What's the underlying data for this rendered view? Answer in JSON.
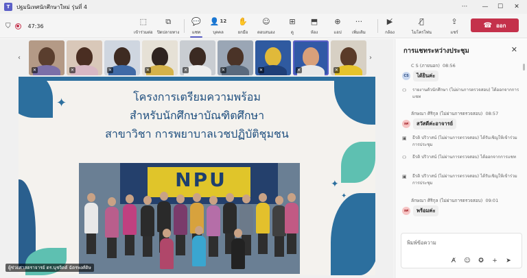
{
  "window": {
    "title": "ปฐมนิเทศนักศึกษาใหม่ รุ่นที่ 4",
    "app_icon": "T"
  },
  "toolbar": {
    "timer": "47:36",
    "buttons": [
      {
        "label": "เข้าร่วมต่อ",
        "icon": "join-icon"
      },
      {
        "label": "ปิดปลายทาง",
        "icon": "panel-icon"
      },
      {
        "label": "แชท",
        "icon": "chat-icon"
      },
      {
        "label": "บุคคล",
        "icon": "people-icon",
        "count": "12"
      },
      {
        "label": "ยกมือ",
        "icon": "raise-hand-icon"
      },
      {
        "label": "ตอบสนอง",
        "icon": "react-icon"
      },
      {
        "label": "ดู",
        "icon": "view-icon"
      },
      {
        "label": "ห้อง",
        "icon": "rooms-icon"
      },
      {
        "label": "แอป",
        "icon": "apps-icon"
      },
      {
        "label": "เพิ่มเติม",
        "icon": "more-icon"
      },
      {
        "label": "กล้อง",
        "icon": "camera-off-icon"
      },
      {
        "label": "ไมโครโฟน",
        "icon": "mic-off-icon"
      },
      {
        "label": "แชร์",
        "icon": "share-icon"
      }
    ],
    "leave_label": "ออก"
  },
  "stage": {
    "presenter_caption": "ผู้ช่วยศาสตราจารย์ ดร.นุชจิตต์ ฉัตรพงศ์ดิษ"
  },
  "slide": {
    "line1": "โครงการเตรียมความพร้อม",
    "line2": "สำหรับนักศึกษาบัณฑิตศึกษา",
    "line3": "สาขาวิชา การพยาบาลเวชปฏิบัติชุมชน",
    "banner_text": "NPU"
  },
  "chat": {
    "title": "การแชทระหว่างประชุม",
    "messages": [
      {
        "sender": "C S (ภายนอก)",
        "time": "08:56",
        "avatar": "CS",
        "text": "ได้ยินค่ะ"
      },
      {
        "event": "รายงานตัวนักศึกษา (ไม่ผ่านการตรวจสอบ) ได้ออกจากการแชท"
      },
      {
        "sender": "ลักษณา ศิริกุล (ไม่ผ่านการตรวจสอบ)",
        "time": "08:57",
        "avatar": "ลศ",
        "text": "สวัสดีค่ะอาจารย์"
      },
      {
        "event": "ธีรติ ปริวาสน์ (ไม่ผ่านการตรวจสอบ) ได้รับเชิญให้เข้าร่วมการประชุม"
      },
      {
        "event": "ธีรติ ปริวาสน์ (ไม่ผ่านการตรวจสอบ) ได้ออกจากการแชท"
      },
      {
        "event": "ธีรติ ปริวาสน์ (ไม่ผ่านการตรวจสอบ) ได้รับเชิญให้เข้าร่วมการประชุม"
      },
      {
        "sender": "ลักษณา ศิริกุล (ไม่ผ่านการตรวจสอบ)",
        "time": "09:01",
        "avatar": "ลศ",
        "text": "พร้อมค่ะ"
      }
    ],
    "compose_placeholder": "พิมพ์ข้อความ"
  },
  "colors": {
    "accent": "#5b5fc7",
    "leave": "#c4314b",
    "slide_blue": "#1e4e7e"
  }
}
